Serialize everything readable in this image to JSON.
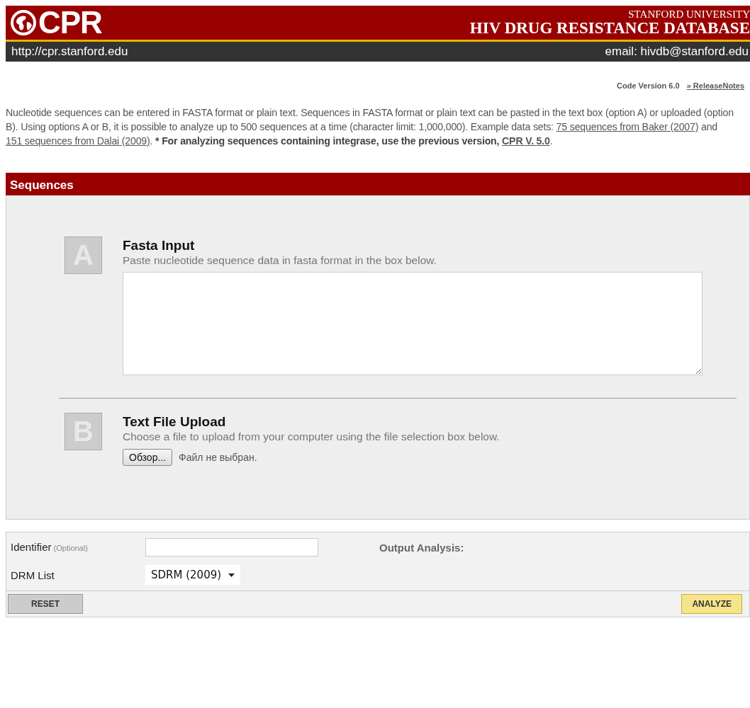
{
  "header": {
    "logo": "CPR",
    "university": "STANFORD UNIVERSITY",
    "database": "HIV DRUG RESISTANCE DATABASE",
    "url": "http://cpr.stanford.edu",
    "email": "email: hivdb@stanford.edu"
  },
  "version": {
    "label": "Code Version 6.0",
    "link": "» ReleaseNotes"
  },
  "intro": [
    {
      "kind": "text",
      "text": "Nucleotide sequences can be entered in FASTA format or plain text. Sequences in FASTA format or plain text can be pasted in the text box (option A) or uploaded (option B). Using options A or B, it is possible to analyze up to 500 sequences at a time (character limit: 1,000,000). Example data sets: "
    },
    {
      "kind": "link",
      "text": "75 sequences from Baker (2007)"
    },
    {
      "kind": "text",
      "text": " and "
    },
    {
      "kind": "link",
      "text": "151 sequences from Dalai (2009)"
    },
    {
      "kind": "text",
      "text": ".  "
    },
    {
      "kind": "bold",
      "text": "* For analyzing sequences containing integrase, use the previous version, "
    },
    {
      "kind": "bold-link",
      "text": "CPR V. 5.0"
    },
    {
      "kind": "text",
      "text": "."
    }
  ],
  "sequences": {
    "title": "Sequences",
    "options": [
      {
        "kind": "textarea",
        "letter": "A",
        "title": "Fasta Input",
        "description": "Paste nucleotide sequence data in fasta format in the box below."
      },
      {
        "kind": "file",
        "letter": "B",
        "title": "Text File Upload",
        "description": "Choose a file to upload from your computer using the file selection box below.",
        "button": "Обзор...",
        "status": "Файл не выбран."
      }
    ]
  },
  "form": {
    "identifier_label": "Identifier",
    "identifier_hint": "(Optional)",
    "output_label": "Output Analysis:",
    "drm_label": "DRM List",
    "drm_value": "SDRM (2009)",
    "reset": "RESET",
    "analyze": "ANALYZE"
  }
}
